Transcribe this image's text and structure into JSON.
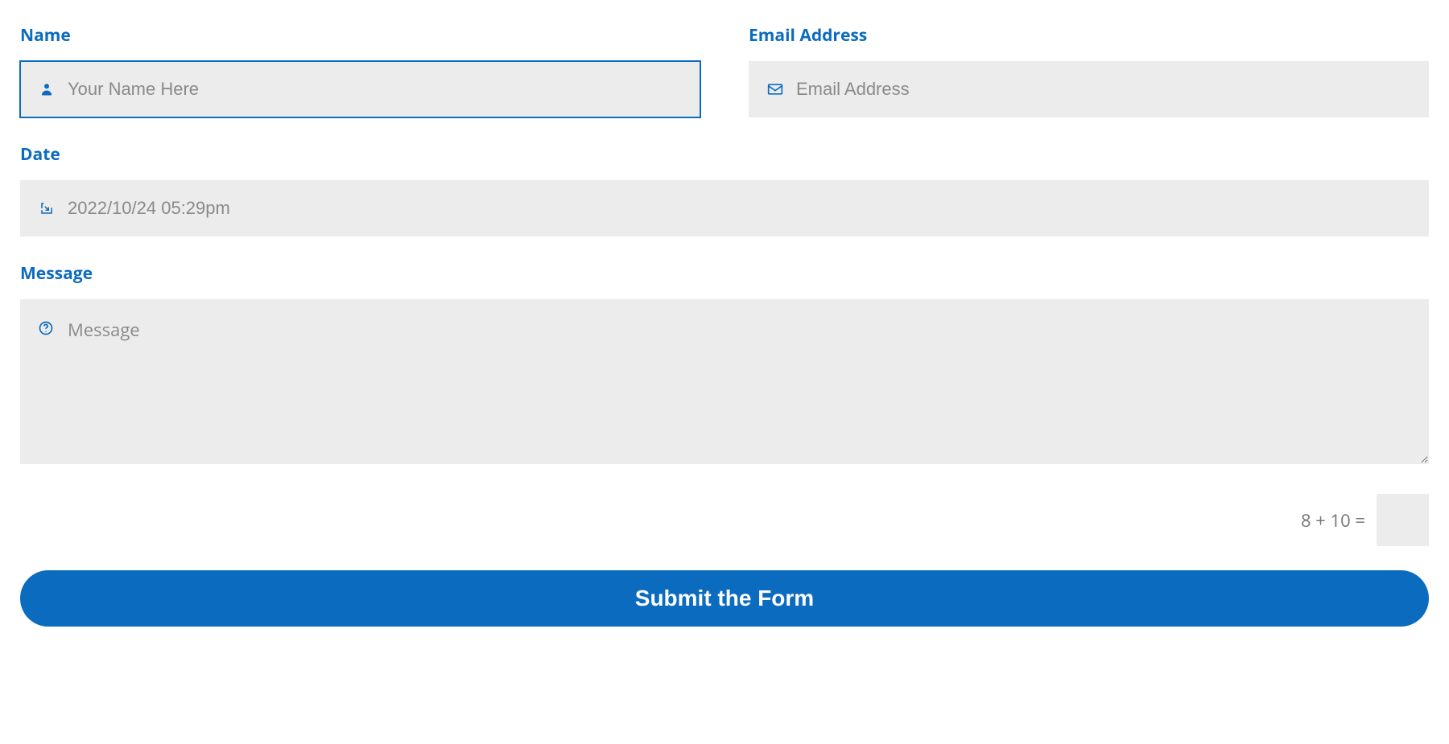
{
  "fields": {
    "name": {
      "label": "Name",
      "placeholder": "Your Name Here",
      "value": ""
    },
    "email": {
      "label": "Email Address",
      "placeholder": "Email Address",
      "value": ""
    },
    "date": {
      "label": "Date",
      "placeholder": "2022/10/24 05:29pm",
      "value": ""
    },
    "message": {
      "label": "Message",
      "placeholder": "Message",
      "value": ""
    }
  },
  "captcha": {
    "question": "8 + 10 ="
  },
  "submit": {
    "label": "Submit the Form"
  },
  "colors": {
    "accent": "#0b6bbf",
    "field_bg": "#ececec",
    "placeholder": "#8a8a8a"
  }
}
